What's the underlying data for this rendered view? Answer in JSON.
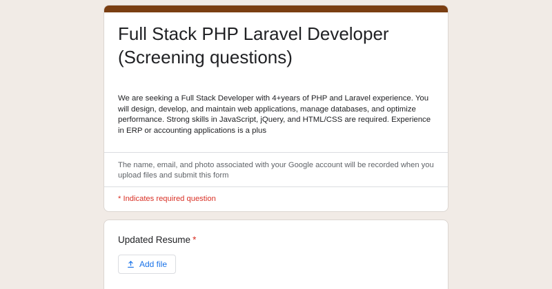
{
  "form": {
    "title": "Full Stack PHP Laravel Developer (Screening questions)",
    "description": "We are seeking a Full Stack Developer with 4+years of PHP and Laravel experience. You will design, develop, and maintain web applications, manage databases, and optimize performance. Strong skills in JavaScript, jQuery, and HTML/CSS are required. Experience in ERP or accounting applications is a plus",
    "account_note": "The name, email, and photo associated with your Google account will be recorded when you upload files and submit this form",
    "required_note": "* Indicates required question"
  },
  "question": {
    "label": "Updated Resume",
    "required_marker": "*",
    "button_label": "Add file",
    "button_icon": "upload-icon"
  },
  "colors": {
    "accent": "#7a3e12",
    "background": "#f1ebe6",
    "required": "#d93025",
    "link": "#1a73e8"
  }
}
